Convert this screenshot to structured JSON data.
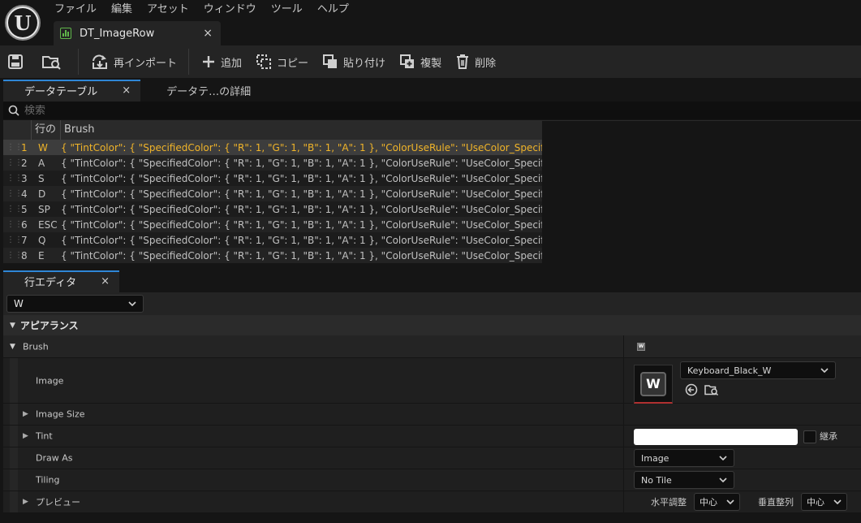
{
  "app": {
    "logo_letter": "U",
    "menu": [
      "ファイル",
      "編集",
      "アセット",
      "ウィンドウ",
      "ツール",
      "ヘルプ"
    ],
    "document_tab": {
      "label": "DT_ImageRow",
      "close": "×"
    }
  },
  "toolbar": {
    "reimport_label": "再インポート",
    "add_label": "追加",
    "copy_label": "コピー",
    "paste_label": "貼り付け",
    "duplicate_label": "複製",
    "delete_label": "削除"
  },
  "data_table_panel": {
    "tabs": [
      {
        "label": "データテーブル",
        "close": "×"
      },
      {
        "label": "データテ…の詳細"
      }
    ],
    "search_placeholder": "検索",
    "columns": {
      "row_name": "行の",
      "brush": "Brush"
    },
    "rows": [
      {
        "index": "1",
        "name": "W",
        "brush": "{ \"TintColor\": { \"SpecifiedColor\": { \"R\": 1, \"G\": 1, \"B\": 1, \"A\": 1 }, \"ColorUseRule\": \"UseColor_Specified\" }, \"DrawAs\": \""
      },
      {
        "index": "2",
        "name": "A",
        "brush": "{ \"TintColor\": { \"SpecifiedColor\": { \"R\": 1, \"G\": 1, \"B\": 1, \"A\": 1 }, \"ColorUseRule\": \"UseColor_Specified\" }, \"DrawAs\": \""
      },
      {
        "index": "3",
        "name": "S",
        "brush": "{ \"TintColor\": { \"SpecifiedColor\": { \"R\": 1, \"G\": 1, \"B\": 1, \"A\": 1 }, \"ColorUseRule\": \"UseColor_Specified\" }, \"DrawAs\": \""
      },
      {
        "index": "4",
        "name": "D",
        "brush": "{ \"TintColor\": { \"SpecifiedColor\": { \"R\": 1, \"G\": 1, \"B\": 1, \"A\": 1 }, \"ColorUseRule\": \"UseColor_Specified\" }, \"DrawAs\": \""
      },
      {
        "index": "5",
        "name": "SP",
        "brush": "{ \"TintColor\": { \"SpecifiedColor\": { \"R\": 1, \"G\": 1, \"B\": 1, \"A\": 1 }, \"ColorUseRule\": \"UseColor_Specified\" }, \"DrawAs\": \""
      },
      {
        "index": "6",
        "name": "ESC",
        "brush": "{ \"TintColor\": { \"SpecifiedColor\": { \"R\": 1, \"G\": 1, \"B\": 1, \"A\": 1 }, \"ColorUseRule\": \"UseColor_Specified\" }, \"DrawAs\": \""
      },
      {
        "index": "7",
        "name": "Q",
        "brush": "{ \"TintColor\": { \"SpecifiedColor\": { \"R\": 1, \"G\": 1, \"B\": 1, \"A\": 1 }, \"ColorUseRule\": \"UseColor_Specified\" }, \"DrawAs\": \""
      },
      {
        "index": "8",
        "name": "E",
        "brush": "{ \"TintColor\": { \"SpecifiedColor\": { \"R\": 1, \"G\": 1, \"B\": 1, \"A\": 1 }, \"ColorUseRule\": \"UseColor_Specified\" }, \"DrawAs\": \""
      }
    ],
    "selected_row_color": "#f0b429"
  },
  "row_editor": {
    "tab": {
      "label": "行エディタ",
      "close": "×"
    },
    "selected_row": "W",
    "section_appearance": "アピアランス",
    "brush_label": "Brush",
    "brush_thumb_letter": "W",
    "properties": {
      "image": {
        "label": "Image",
        "asset": "Keyboard_Black_W",
        "thumb_letter": "W"
      },
      "image_size": {
        "label": "Image Size"
      },
      "tint": {
        "label": "Tint",
        "color": "#ffffff",
        "inherit_label": "継承"
      },
      "draw_as": {
        "label": "Draw As",
        "value": "Image"
      },
      "tiling": {
        "label": "Tiling",
        "value": "No Tile"
      },
      "preview": {
        "label": "プレビュー",
        "h_align_label": "水平調整",
        "h_align_value": "中心",
        "v_align_label": "垂直整列",
        "v_align_value": "中心"
      }
    }
  }
}
